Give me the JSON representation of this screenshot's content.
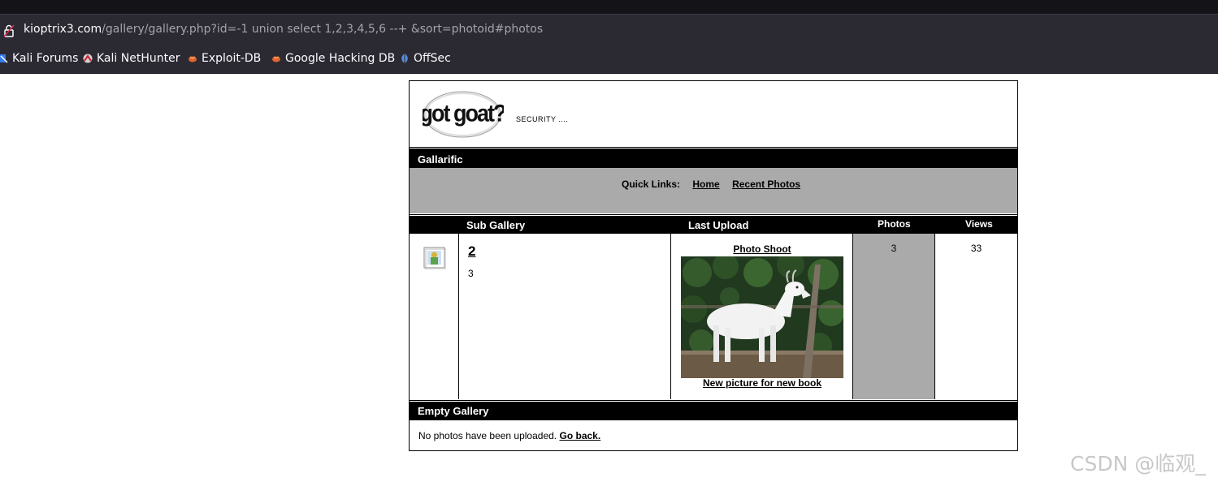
{
  "browser": {
    "url_domain": "kioptrix3.com",
    "url_path": "/gallery/gallery.php?id=-1 union select 1,2,3,4,5,6 --+ &sort=photoid#photos",
    "bookmarks": [
      {
        "label": "Kali Forums",
        "icon": "kali-forums-icon"
      },
      {
        "label": "Kali NetHunter",
        "icon": "nethunter-icon"
      },
      {
        "label": "Exploit-DB",
        "icon": "exploit-db-icon"
      },
      {
        "label": "Google Hacking DB",
        "icon": "ghdb-icon"
      },
      {
        "label": "OffSec",
        "icon": "offsec-icon"
      }
    ]
  },
  "site": {
    "logo_text": "got goat?",
    "tagline": "SECURITY ...."
  },
  "gallery": {
    "title": "Gallarific",
    "quick_links_label": "Quick Links:",
    "quick_links": [
      "Home",
      "Recent Photos"
    ]
  },
  "table": {
    "headers": {
      "sub_gallery": "Sub Gallery",
      "last_upload": "Last Upload",
      "photos": "Photos",
      "views": "Views"
    },
    "row": {
      "name": "2",
      "count": "3",
      "upload_title": "Photo Shoot",
      "upload_caption": "New picture for new book",
      "photos": "3",
      "views": "33"
    }
  },
  "empty": {
    "title": "Empty Gallery",
    "message": "No photos have been uploaded.",
    "go_back": "Go back."
  },
  "watermark": "CSDN @临观_"
}
